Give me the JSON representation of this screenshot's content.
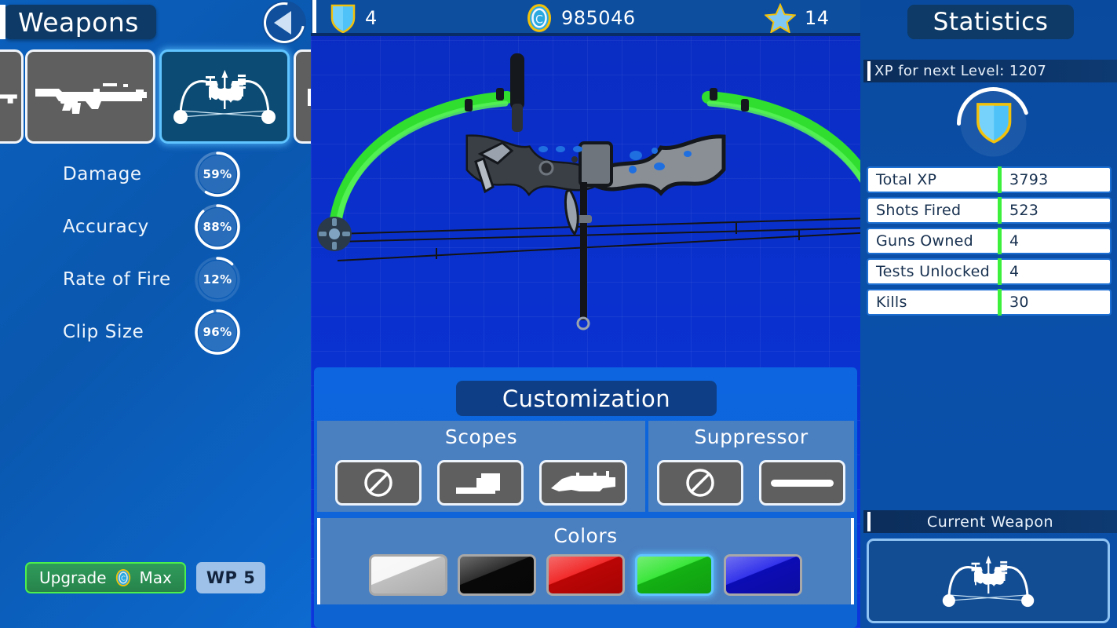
{
  "header": {
    "title": "Weapons",
    "back_icon": "back-triangle-icon"
  },
  "weapon_tabs": [
    {
      "icon": "rifle-silhouette-icon",
      "selected": false,
      "partial": "left"
    },
    {
      "icon": "ak47-silhouette-icon",
      "selected": false,
      "partial": "none"
    },
    {
      "icon": "compound-bow-silhouette-icon",
      "selected": true,
      "partial": "none"
    },
    {
      "icon": "pistol-silhouette-icon",
      "selected": false,
      "partial": "right"
    }
  ],
  "weapon_stats": [
    {
      "label": "Damage",
      "value": 59,
      "display": "59%"
    },
    {
      "label": "Accuracy",
      "value": 88,
      "display": "88%"
    },
    {
      "label": "Rate of Fire",
      "value": 12,
      "display": "12%"
    },
    {
      "label": "Clip Size",
      "value": 96,
      "display": "96%"
    }
  ],
  "upgrade": {
    "label": "Upgrade",
    "cost_label": "Max",
    "coin_icon": "coin-icon",
    "weapon_points_badge": "WP 5"
  },
  "topbar": {
    "shield": {
      "icon": "shield-icon",
      "value": "4"
    },
    "coins": {
      "icon": "coin-icon",
      "value": "985046"
    },
    "stars": {
      "icon": "star-icon",
      "value": "14"
    }
  },
  "customization": {
    "title": "Customization",
    "scopes": {
      "title": "Scopes",
      "options": [
        {
          "icon": "no-scope-icon",
          "selected": false
        },
        {
          "icon": "red-dot-sight-icon",
          "selected": false
        },
        {
          "icon": "long-scope-icon",
          "selected": false
        }
      ]
    },
    "suppressor": {
      "title": "Suppressor",
      "options": [
        {
          "icon": "no-suppressor-icon",
          "selected": false
        },
        {
          "icon": "suppressor-icon",
          "selected": false
        }
      ]
    },
    "colors": {
      "title": "Colors",
      "options": [
        {
          "name": "white",
          "hex": "#f5f5f5",
          "selected": false
        },
        {
          "name": "black",
          "hex": "#0a0a0a",
          "selected": false
        },
        {
          "name": "red",
          "hex": "#ef0606",
          "selected": false
        },
        {
          "name": "green",
          "hex": "#18e218",
          "selected": true
        },
        {
          "name": "blue",
          "hex": "#1010e8",
          "selected": false
        }
      ]
    }
  },
  "statistics": {
    "title": "Statistics",
    "xp_for_next_level_label": "XP for next Level: 1207",
    "xp_progress_percent": 45,
    "level_icon": "shield-icon",
    "rows": [
      {
        "key": "Total XP",
        "value": "3793"
      },
      {
        "key": "Shots Fired",
        "value": "523"
      },
      {
        "key": "Guns Owned",
        "value": "4"
      },
      {
        "key": "Tests Unlocked",
        "value": "4"
      },
      {
        "key": "Kills",
        "value": "30"
      }
    ],
    "current_weapon": {
      "title": "Current Weapon",
      "icon": "compound-bow-silhouette-icon"
    }
  },
  "theme": {
    "accent_green": "#3cf03c",
    "panel_blue": "#0a5cb8",
    "blueprint_blue": "#0a2cc2",
    "badge_navy": "#0d3a66",
    "selection_cyan": "#5fc4ff"
  }
}
